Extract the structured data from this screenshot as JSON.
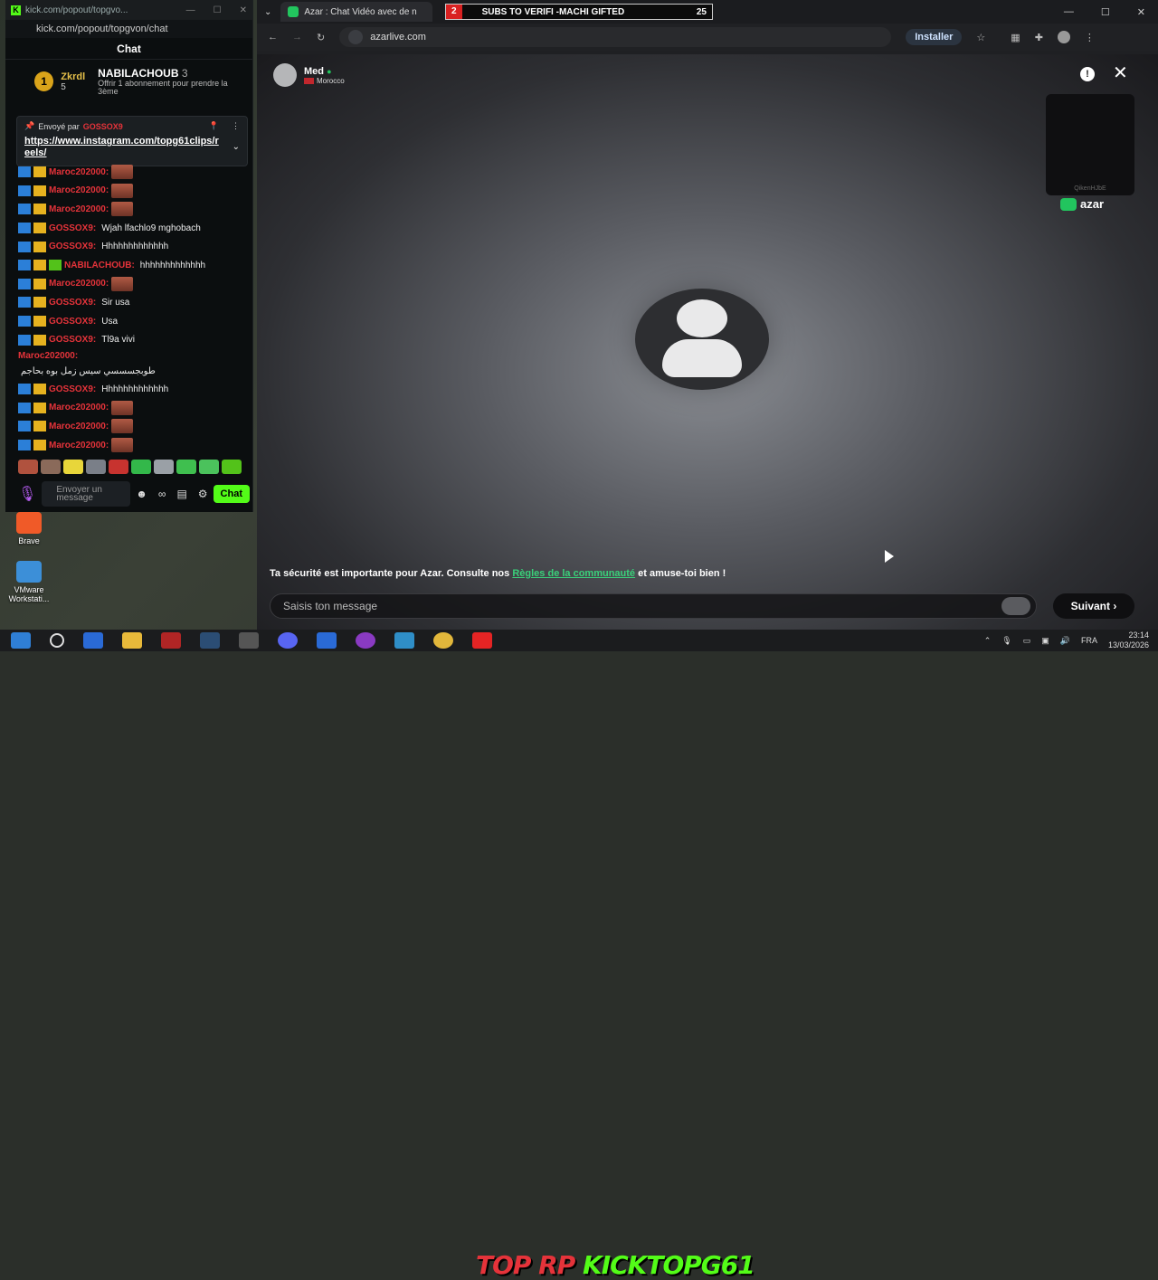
{
  "desktop": {
    "icons": [
      {
        "label": "Brave"
      },
      {
        "label": "VMware Workstati..."
      }
    ]
  },
  "kick": {
    "window_title": "kick.com/popout/topgvo...",
    "url": "kick.com/popout/topgvon/chat",
    "header": "Chat",
    "leaderboard": {
      "rank": "1",
      "first_name": "Zkrdl",
      "first_count": "5",
      "second_name": "NABILACHOUB",
      "second_count": "3",
      "third_rank": "3",
      "third_text": "Offrir 1 abonnement pour prendre la 3ème"
    },
    "pinned": {
      "sent_by_label": "Envoyé par",
      "sent_by_user": "GOSSOX9",
      "link": "https://www.instagram.com/topg61clips/reels/"
    },
    "messages": [
      {
        "user": "Maroc202000:",
        "text": "",
        "emote": true,
        "badge": "b1"
      },
      {
        "user": "Maroc202000:",
        "text": "",
        "emote": true,
        "badge": "b1"
      },
      {
        "user": "Maroc202000:",
        "text": "",
        "emote": true,
        "badge": "b1"
      },
      {
        "user": "GOSSOX9:",
        "text": "Wjah lfachlo9 mghobach",
        "emote": false,
        "badge": "b2"
      },
      {
        "user": "GOSSOX9:",
        "text": "Hhhhhhhhhhhhh",
        "emote": false,
        "badge": "b2"
      },
      {
        "user": "NABILACHOUB:",
        "text": "hhhhhhhhhhhhh",
        "emote": false,
        "badge": "b3"
      },
      {
        "user": "Maroc202000:",
        "text": "",
        "emote": true,
        "badge": "b1"
      },
      {
        "user": "GOSSOX9:",
        "text": "Sir usa",
        "emote": false,
        "badge": "b2"
      },
      {
        "user": "GOSSOX9:",
        "text": "Usa",
        "emote": false,
        "badge": "b2"
      },
      {
        "user": "GOSSOX9:",
        "text": "Tl9a vivi",
        "emote": false,
        "badge": "b2"
      },
      {
        "user": "Maroc202000:",
        "text": "طوبجسسسي سيس زمل بوه بحاجم",
        "emote": false,
        "badge": "none",
        "tall": true
      },
      {
        "user": "GOSSOX9:",
        "text": "Hhhhhhhhhhhhh",
        "emote": false,
        "badge": "b2"
      },
      {
        "user": "Maroc202000:",
        "text": "",
        "emote": true,
        "badge": "b1"
      },
      {
        "user": "Maroc202000:",
        "text": "",
        "emote": true,
        "badge": "b1"
      },
      {
        "user": "Maroc202000:",
        "text": "",
        "emote": true,
        "badge": "b1"
      }
    ],
    "input_placeholder": "Envoyer un message",
    "chat_button": "Chat",
    "emote_colors": [
      "#b0523e",
      "#8a6a5a",
      "#e8d63a",
      "#7a7f88",
      "#c7332f",
      "#33b84a",
      "#9aa0a6",
      "#3fbf4f",
      "#4bc25c",
      "#53c21a"
    ]
  },
  "browser": {
    "tab_title": "Azar : Chat Vidéo avec de n",
    "overlay": {
      "count_left": "2",
      "text": "SUBS TO VERIFI -MACHI GIFTED",
      "count_right": "25"
    },
    "url": "azarlive.com",
    "install_label": "Installer"
  },
  "azar": {
    "peer_name": "Med",
    "peer_country": "Morocco",
    "self_cam_tag": "QikenHJbE",
    "brand": "azar",
    "safety_prefix": "Ta sécurité est importante pour Azar. Consulte nos ",
    "safety_link": "Règles de la communauté",
    "safety_suffix": " et amuse-toi bien !",
    "message_placeholder": "Saisis ton message",
    "next_label": "Suivant"
  },
  "taskbar": {
    "overlay_text_red": "TOP RP",
    "overlay_text_green": "KICKTOPG61",
    "language": "FRA",
    "time": "23:14",
    "date": "13/03/2026"
  }
}
